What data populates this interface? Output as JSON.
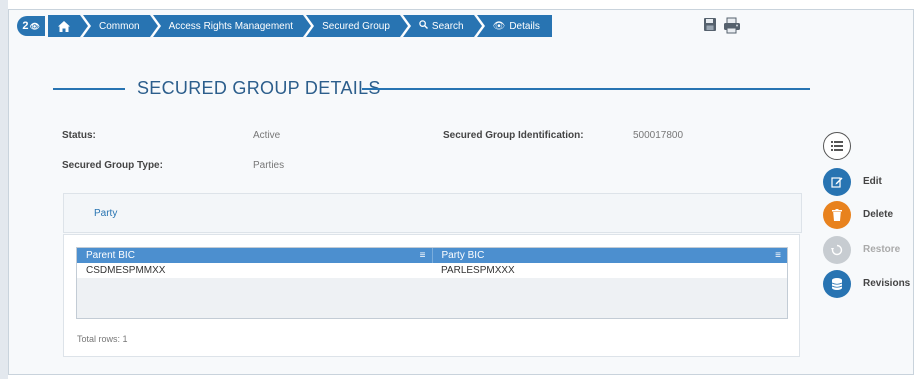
{
  "breadcrumb": {
    "badge_count": "2",
    "items": [
      "Common",
      "Access Rights Management",
      "Secured Group",
      "Search",
      "Details"
    ]
  },
  "page_title": "SECURED GROUP DETAILS",
  "details": {
    "status_label": "Status:",
    "status_value": "Active",
    "identification_label": "Secured Group Identification:",
    "identification_value": "500017800",
    "type_label": "Secured Group Type:",
    "type_value": "Parties"
  },
  "party_section": {
    "tab_label": "Party",
    "columns": [
      "Parent BIC",
      "Party BIC"
    ],
    "rows": [
      [
        "CSDMESPMMXX",
        "PARLESPMXXX"
      ]
    ],
    "total_rows": "Total rows: 1"
  },
  "actions": {
    "edit": "Edit",
    "delete": "Delete",
    "restore": "Restore",
    "revisions": "Revisions"
  },
  "colors": {
    "primary": "#2874b2",
    "delete": "#e8821e",
    "disabled": "#c7ccd1",
    "header": "#4c8fcf"
  },
  "icons": [
    "eye-icon",
    "home-icon",
    "search-icon",
    "save-icon",
    "print-icon",
    "list-icon",
    "edit-icon",
    "trash-icon",
    "restore-icon",
    "database-icon"
  ]
}
